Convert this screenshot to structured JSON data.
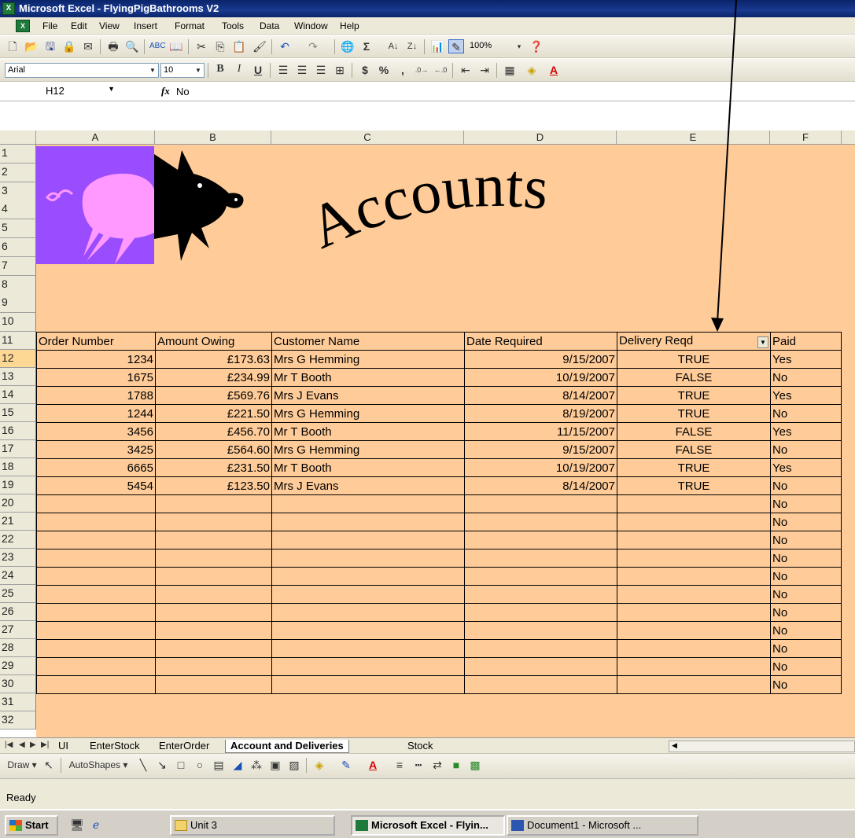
{
  "window": {
    "title": "Microsoft Excel - FlyingPigBathrooms V2"
  },
  "menubar": {
    "items": [
      "File",
      "Edit",
      "View",
      "Insert",
      "Format",
      "Tools",
      "Data",
      "Window",
      "Help"
    ]
  },
  "toolbar_standard": {
    "zoom": "100%"
  },
  "toolbar_formatting": {
    "font_name": "Arial",
    "font_size": "10",
    "currency": "$",
    "percent": "%"
  },
  "formula_bar": {
    "name_box": "H12",
    "fx": "fx",
    "content": "No"
  },
  "columns": [
    "A",
    "B",
    "C",
    "D",
    "E",
    "F"
  ],
  "rows": [
    "1",
    "2",
    "3",
    "4",
    "5",
    "6",
    "7",
    "8",
    "9",
    "10",
    "11",
    "12",
    "13",
    "14",
    "15",
    "16",
    "17",
    "18",
    "19",
    "20",
    "21",
    "22",
    "23",
    "24",
    "25",
    "26",
    "27",
    "28",
    "29",
    "30",
    "31",
    "32"
  ],
  "banner": {
    "text": "Accounts"
  },
  "table": {
    "headers": [
      "Order Number",
      "Amount Owing",
      "Customer Name",
      "Date Required",
      "Delivery Reqd",
      "Paid"
    ],
    "rows": [
      [
        "1234",
        "£173.63",
        "Mrs G Hemming",
        "9/15/2007",
        "TRUE",
        "Yes"
      ],
      [
        "1675",
        "£234.99",
        "Mr T Booth",
        "10/19/2007",
        "FALSE",
        "No"
      ],
      [
        "1788",
        "£569.76",
        "Mrs J Evans",
        "8/14/2007",
        "TRUE",
        "Yes"
      ],
      [
        "1244",
        "£221.50",
        "Mrs G Hemming",
        "8/19/2007",
        "TRUE",
        "No"
      ],
      [
        "3456",
        "£456.70",
        "Mr T Booth",
        "11/15/2007",
        "FALSE",
        "Yes"
      ],
      [
        "3425",
        "£564.60",
        "Mrs G Hemming",
        "9/15/2007",
        "FALSE",
        "No"
      ],
      [
        "6665",
        "£231.50",
        "Mr T Booth",
        "10/19/2007",
        "TRUE",
        "Yes"
      ],
      [
        "5454",
        "£123.50",
        "Mrs J Evans",
        "8/14/2007",
        "TRUE",
        "No"
      ],
      [
        "",
        "",
        "",
        "",
        "",
        "No"
      ],
      [
        "",
        "",
        "",
        "",
        "",
        "No"
      ],
      [
        "",
        "",
        "",
        "",
        "",
        "No"
      ],
      [
        "",
        "",
        "",
        "",
        "",
        "No"
      ],
      [
        "",
        "",
        "",
        "",
        "",
        "No"
      ],
      [
        "",
        "",
        "",
        "",
        "",
        "No"
      ],
      [
        "",
        "",
        "",
        "",
        "",
        "No"
      ],
      [
        "",
        "",
        "",
        "",
        "",
        "No"
      ],
      [
        "",
        "",
        "",
        "",
        "",
        "No"
      ],
      [
        "",
        "",
        "",
        "",
        "",
        "No"
      ],
      [
        "",
        "",
        "",
        "",
        "",
        "No"
      ]
    ]
  },
  "sheet_tabs": {
    "items": [
      "UI",
      "EnterStock",
      "EnterOrder",
      "Account and Deliveries",
      "Stock"
    ],
    "active": "Account and Deliveries"
  },
  "drawing_toolbar": {
    "draw_label": "Draw ▾",
    "autoshapes_label": "AutoShapes ▾"
  },
  "status": {
    "text": "Ready"
  },
  "taskbar": {
    "start_label": "Start",
    "buttons": [
      "Unit 3",
      "Microsoft Excel - Flyin...",
      "Document1 - Microsoft ..."
    ]
  },
  "colors": {
    "sheet_fill": "#ffcc99",
    "pig_purple": "#9a4dff",
    "pig_pink": "#ff99ff",
    "titlebar": "#0a246a"
  }
}
